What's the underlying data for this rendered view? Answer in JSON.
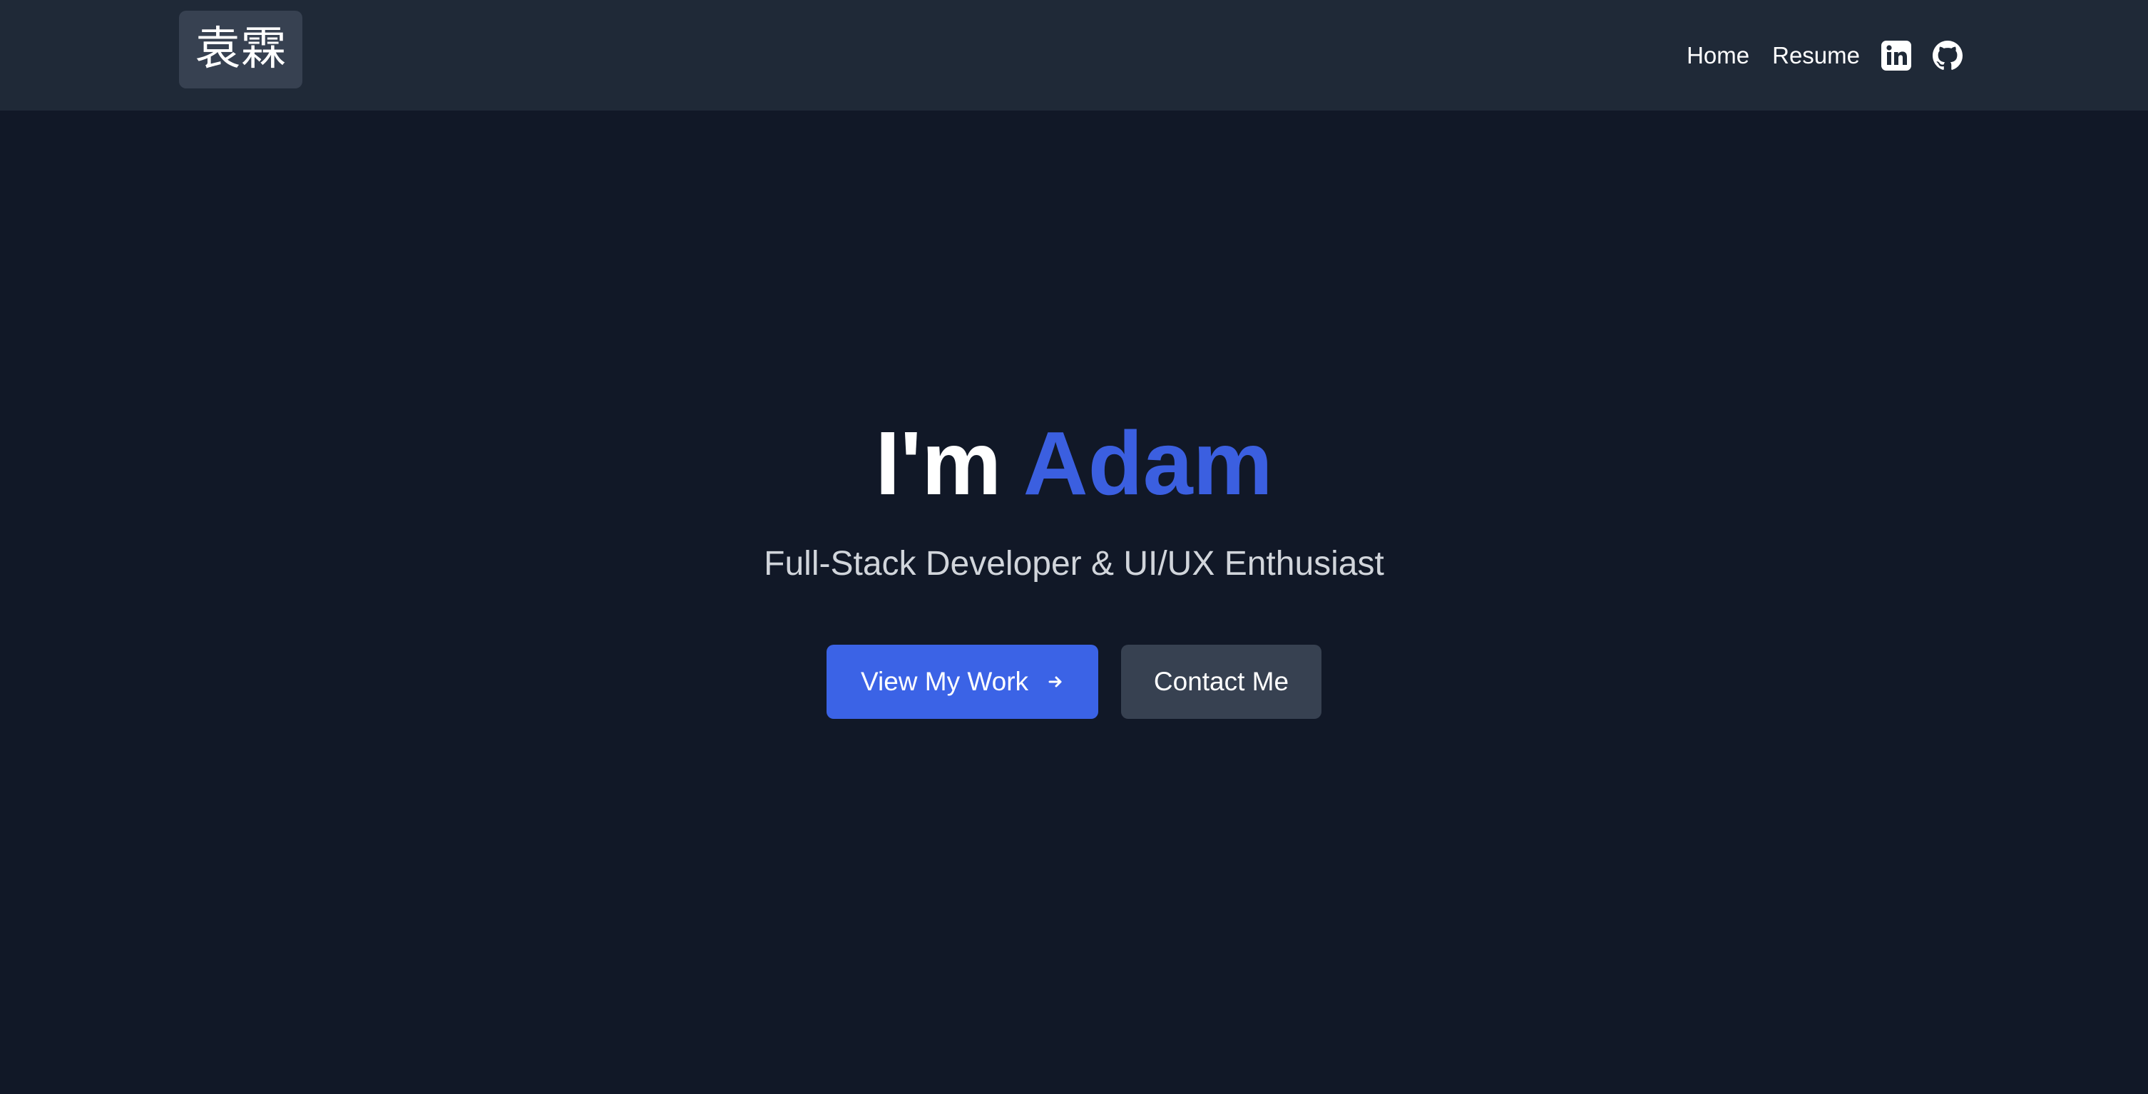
{
  "header": {
    "logo_text": "袁霖",
    "nav": {
      "home_label": "Home",
      "resume_label": "Resume"
    },
    "social": {
      "linkedin_icon": "linkedin-icon",
      "github_icon": "github-icon"
    }
  },
  "hero": {
    "greeting": "I'm",
    "name": "Adam",
    "subtitle": "Full-Stack Developer & UI/UX Enthusiast",
    "primary_button_label": "View My Work",
    "primary_button_icon": "arrow-right-icon",
    "secondary_button_label": "Contact Me"
  },
  "colors": {
    "page_background": "#111827",
    "header_background": "#1f2937",
    "accent": "#3b63e6",
    "secondary_button": "#374151",
    "subtitle_text": "#d1d5db"
  }
}
